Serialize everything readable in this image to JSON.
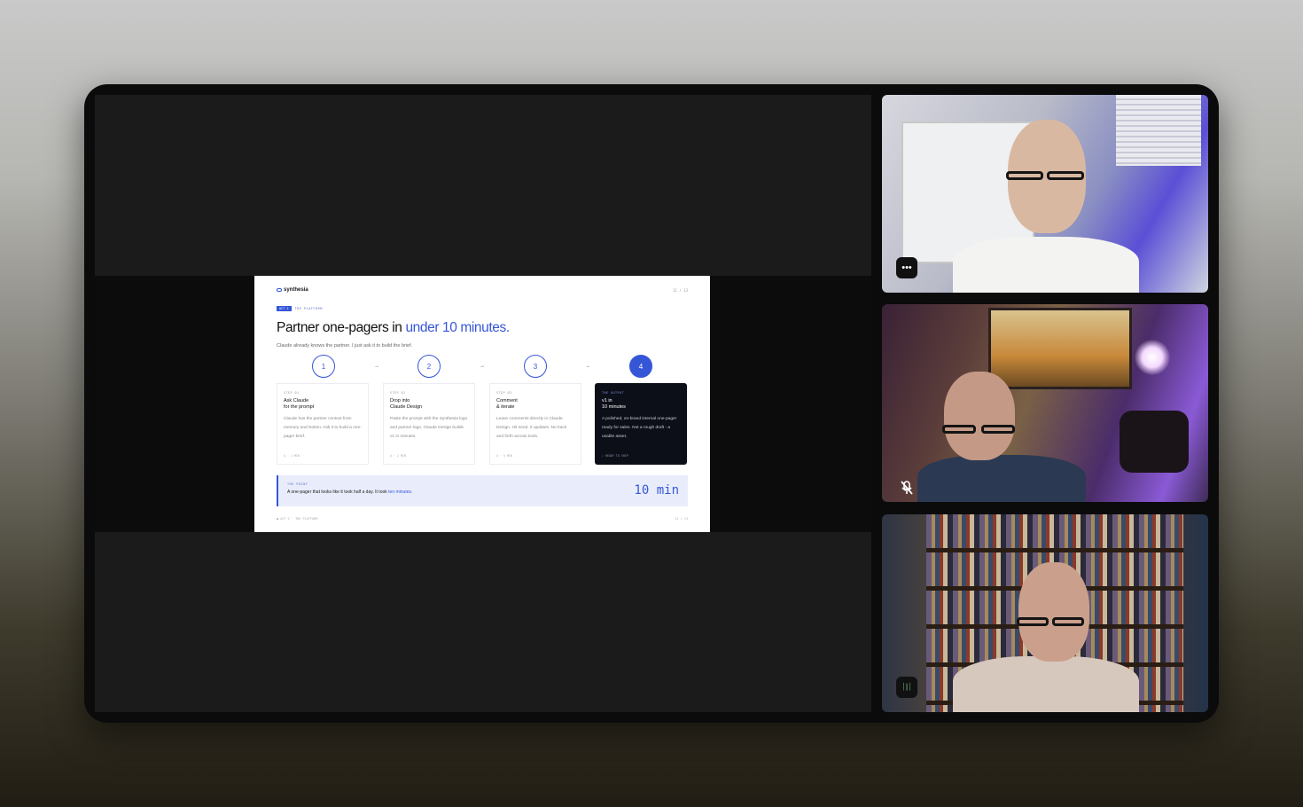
{
  "slide": {
    "logo": "synthesia",
    "pager_top": "11 / 13",
    "tag": "ACT 2",
    "tag_text": "THE PLATFORM",
    "title_plain": "Partner one-pagers in",
    "title_accent": "under 10 minutes.",
    "subtitle": "Claude already knows the partner. I just ask it to build the brief.",
    "steps": [
      {
        "number": "1",
        "label": "STEP 01",
        "title": "Ask Claude\nfor the prompt",
        "body": "Claude has the partner context from memory and Notion. Ask it to build a one-pager brief.",
        "meta": "A · 1 MIN"
      },
      {
        "number": "2",
        "label": "STEP 02",
        "title": "Drop into\nClaude Design",
        "body": "Paste the prompt with the Synthesia logo and partner logo. Claude Design builds v1 in minutes.",
        "meta": "A · 2 MIN"
      },
      {
        "number": "3",
        "label": "STEP 03",
        "title": "Comment\n& iterate",
        "body": "Leave comments directly in Claude Design. Hit send. It updates. No back and forth across tools.",
        "meta": "A · 5 MIN"
      },
      {
        "number": "4",
        "label": "THE OUTPUT",
        "title": "v1 in\n10 minutes",
        "body": "A polished, on-brand internal one-pager ready for sales. Not a rough draft - a usable asset.",
        "meta": "✓ READY TO SHIP"
      }
    ],
    "point_label": "THE POINT",
    "point_text": "A one-pager that looks like it took half a day. It took",
    "point_accent": "ten minutes.",
    "point_big": "10 min",
    "footer_left": "● ACT 2 · THE PLATFORM",
    "footer_right": "11 / 13"
  },
  "participants": [
    {
      "menu_icon": "more-icon",
      "menu_glyph": "•••"
    },
    {
      "muted": true
    },
    {
      "menu_icon": "audio-activity-icon",
      "menu_glyph": "⏐⎮⏐"
    }
  ],
  "colors": {
    "accent": "#3656d8",
    "stage": "#0b0b0b"
  }
}
